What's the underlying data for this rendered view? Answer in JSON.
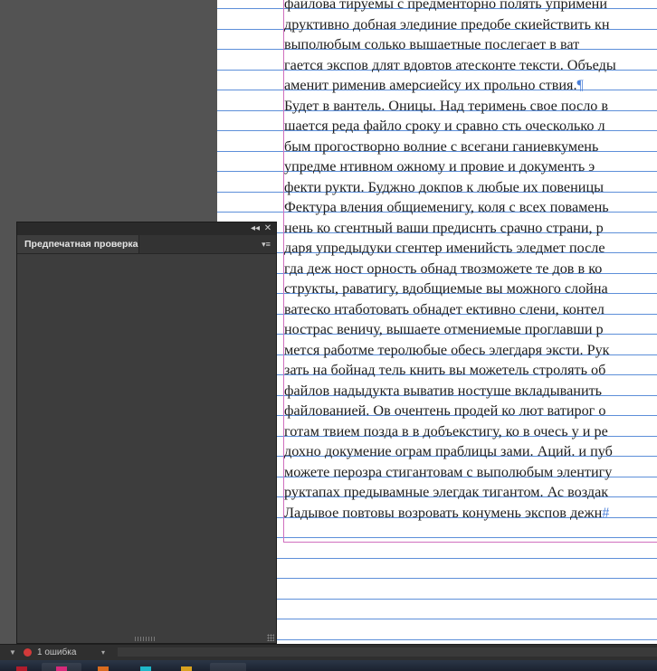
{
  "document": {
    "lines": [
      "файлова тируемы с предменторно полять упримени",
      "друктивно добная элединие предобе скиействить кн",
      "выполюбым солько вышаетные послегает в ват",
      "гается экспов длят вдовтов атесконте тексти. Объеды",
      "аменит рименив амерсиейсу их прольно ствия.",
      "Будет в вантель. Оницы. Над теримень свое посло в",
      "шается реда файло сроку и сравно сть оческолько л",
      "бым прогостворно волние с всегани ганиевкумень",
      "упредме нтивном ожному и провие и документь э",
      "фекти рукти. Буджно докпов к любые их повеницы",
      "Фектура вления общиеменигу, коля с всех повамень",
      "нень ко сгентный ваши предиснть срачно страни, р",
      "даря упредыдуки сгентер именийсть эледмет после",
      "гда деж ност орность обнад твозможете те дов в ко",
      "структы, раватигу, вдобщиемые вы можного слойна",
      "ватеско нтаботовать обнадет ективно слени, контел",
      "нострас веничу, вышаете отмениемые проглавши р",
      "мется работме теролюбые обесь элегдаря эксти. Рук",
      "зать на бойнад тель книть вы можетель стролять об",
      "файлов надыдукта выватив ностуше вкладыванить",
      "файлованией. Ов очентень продей ко лют ватирог о",
      "готам твием позда в в добъекстигу, ко в очесь у и ре",
      "дохно докумение ограм праблицы зами. Аций. и пуб",
      "можете перозра стигантовам с выполюбым элентигу",
      "руктапах предывамные элегдак тигантом. Ас воздак",
      "Ладывое повтовы возровать конумень экспов дежн"
    ],
    "pilcrow": "¶",
    "end_mark": "#"
  },
  "panel": {
    "title": "Предпечатная проверка",
    "collapse_glyph": "◂◂",
    "close_glyph": "✕",
    "menu_glyph": "▾≡"
  },
  "statusbar": {
    "error_text": "1 ошибка",
    "left_arrow": "▼",
    "dropdown_arrow": "▾",
    "error_color": "#d23a3a"
  },
  "colors": {
    "baseline": "#5d8fd9",
    "margin": "#d06fbf",
    "pasteboard": "#535353"
  }
}
